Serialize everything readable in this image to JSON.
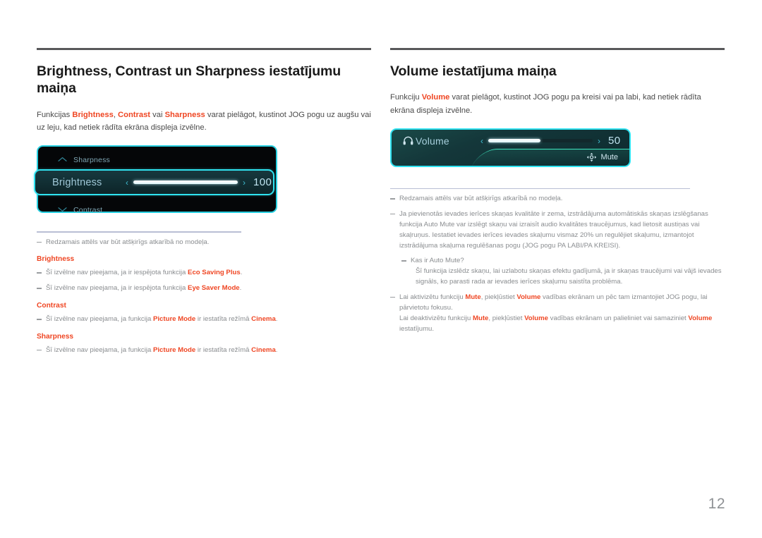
{
  "page_number": "12",
  "left": {
    "title": "Brightness, Contrast un Sharpness iestatījumu maiņa",
    "intro": {
      "p1": "Funkcijas ",
      "kw1": "Brightness",
      "p2": ", ",
      "kw2": "Contrast",
      "p3": " vai ",
      "kw3": "Sharpness",
      "p4": " varat pielāgot, kustinot JOG pogu uz augšu vai uz leju, kad netiek rādīta ekrāna displeja izvēlne."
    },
    "osd": {
      "top_row": {
        "icon": "chevron-up-icon",
        "label": "Sharpness"
      },
      "highlighted_row": {
        "label": "Brightness",
        "value": "100",
        "fill_percent": 100,
        "left_arrow": "‹",
        "right_arrow": "›"
      },
      "bottom_row": {
        "icon": "chevron-down-icon",
        "label": "Contrast"
      }
    },
    "notes": [
      {
        "text": "Redzamais attēls var būt atšķirīgs atkarībā no modeļa."
      }
    ],
    "groups": [
      {
        "heading": "Brightness",
        "notes": [
          {
            "pre": "Šī izvēlne nav pieejama, ja ir iespējota funkcija ",
            "kw": "Eco Saving Plus",
            "post": "."
          },
          {
            "pre": "Šī izvēlne nav pieejama, ja ir iespējota funkcija ",
            "kw": "Eye Saver Mode",
            "post": "."
          }
        ]
      },
      {
        "heading": "Contrast",
        "notes": [
          {
            "pre": "Šī izvēlne nav pieejama, ja funkcija ",
            "kw": "Picture Mode",
            "mid": " ir iestatīta režīmā ",
            "kw2": "Cinema",
            "post": "."
          }
        ]
      },
      {
        "heading": "Sharpness",
        "notes": [
          {
            "pre": "Šī izvēlne nav pieejama, ja funkcija ",
            "kw": "Picture Mode",
            "mid": " ir iestatīta režīmā ",
            "kw2": "Cinema",
            "post": "."
          }
        ]
      }
    ]
  },
  "right": {
    "title": "Volume iestatījuma maiņa",
    "intro": {
      "p1": "Funkciju ",
      "kw1": "Volume",
      "p2": " varat pielāgot, kustinot JOG pogu pa kreisi vai pa labi, kad netiek rādīta ekrāna displeja izvēlne."
    },
    "osd": {
      "icon": "headphone-icon",
      "label": "Volume",
      "value": "50",
      "fill_percent": 50,
      "left_arrow": "‹",
      "right_arrow": "›",
      "mute_icon": "jog-button-icon",
      "mute_label": "Mute"
    },
    "notes": [
      {
        "text": "Redzamais attēls var būt atšķirīgs atkarībā no modeļa."
      },
      {
        "text": "Ja pievienotās ievades ierīces skaņas kvalitāte ir zema, izstrādājuma automātiskās skaņas izslēgšanas funkcija Auto Mute var izslēgt skaņu vai izraisīt audio kvalitātes traucējumus, kad lietosit austiņas vai skaļruņus. Iestatiet ievades ierīces ievades skaļumu vismaz 20% un regulējiet skaļumu, izmantojot izstrādājuma skaļuma regulēšanas pogu (JOG pogu PA LABI/PA KREISI)."
      }
    ],
    "sub_note": {
      "question": "Kas ir Auto Mute?",
      "answer": "Šī funkcija izslēdz skaņu, lai uzlabotu skaņas efektu gadījumā, ja ir skaņas traucējumi vai vājš ievades signāls, ko parasti rada ar ievades ierīces skaļumu saistīta problēma."
    },
    "mute_note": {
      "l1_p1": "Lai aktivizētu funkciju ",
      "l1_kw1": "Mute",
      "l1_p2": ", piekļūstiet ",
      "l1_kw2": "Volume",
      "l1_p3": " vadības ekrānam un pēc tam izmantojiet JOG pogu, lai pārvietotu fokusu.",
      "l2_p1": "Lai deaktivizētu funkciju ",
      "l2_kw1": "Mute",
      "l2_p2": ", piekļūstiet ",
      "l2_kw2": "Volume",
      "l2_p3": " vadības ekrānam un palieliniet vai samaziniet ",
      "l2_kw3": "Volume",
      "l2_p4": " iestatījumu."
    }
  },
  "colors": {
    "accent_red": "#ef4623",
    "osd_border_cyan": "#2fe2f0",
    "osd_green": "#3fe8c0",
    "rule_dark": "#58585a"
  }
}
